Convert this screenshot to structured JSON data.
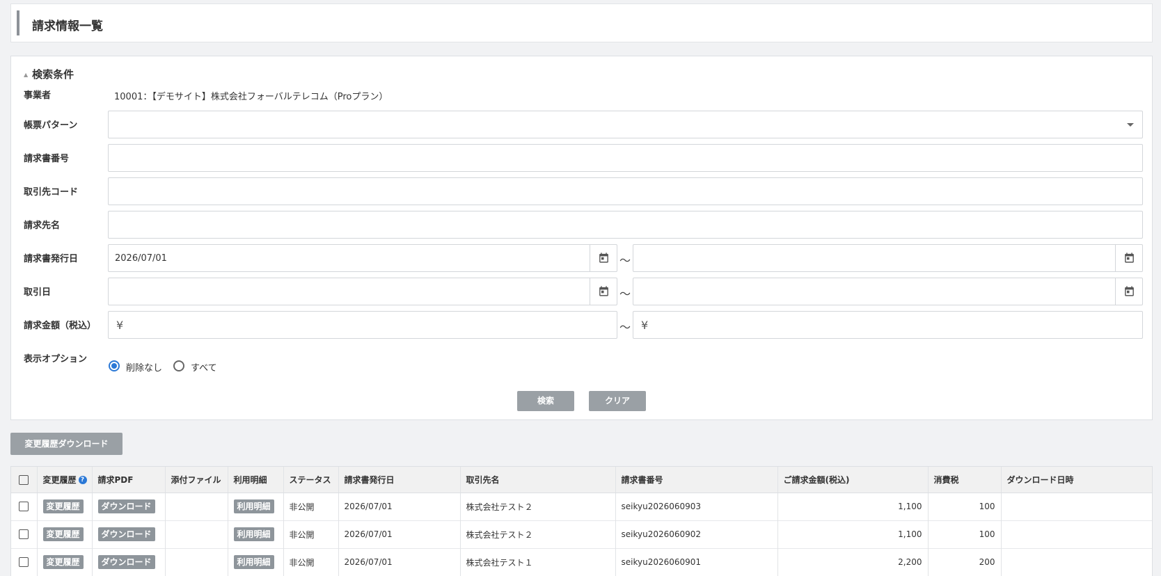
{
  "page": {
    "title": "請求情報一覧"
  },
  "search": {
    "section_title": "検索条件",
    "labels": {
      "business": "事業者",
      "pattern": "帳票パターン",
      "invoice_no": "請求書番号",
      "client_code": "取引先コード",
      "billing_name": "請求先名",
      "issue_date": "請求書発行日",
      "trade_date": "取引日",
      "amount": "請求金額（税込）",
      "display_option": "表示オプション"
    },
    "business_value": "10001：【デモサイト】株式会社フォーバルテレコム（Proプラン）",
    "pattern_value": "",
    "invoice_no_value": "",
    "client_code_value": "",
    "billing_name_value": "",
    "issue_date_from": "2026/07/01",
    "issue_date_to": "",
    "trade_date_from": "",
    "trade_date_to": "",
    "amount_prefix": "¥",
    "amount_from": "",
    "amount_to": "",
    "range_sep": "～",
    "option_no_delete": "削除なし",
    "option_all": "すべて",
    "selected_option": "削除なし",
    "search_button": "検索",
    "clear_button": "クリア"
  },
  "history_download_button": "変更履歴ダウンロード",
  "table": {
    "headers": [
      "変更履歴",
      "請求PDF",
      "添付ファイル",
      "利用明細",
      "ステータス",
      "請求書発行日",
      "取引先名",
      "請求書番号",
      "ご請求金額(税込)",
      "消費税",
      "ダウンロード日時"
    ],
    "history_button": "変更履歴",
    "download_button": "ダウンロード",
    "detail_button": "利用明細",
    "rows": [
      {
        "status": "非公開",
        "issue_date": "2026/07/01",
        "client": "株式会社テスト２",
        "invoice_no": "seikyu2026060903",
        "amount": "1,100",
        "tax": "100",
        "download_at": ""
      },
      {
        "status": "非公開",
        "issue_date": "2026/07/01",
        "client": "株式会社テスト２",
        "invoice_no": "seikyu2026060902",
        "amount": "1,100",
        "tax": "100",
        "download_at": ""
      },
      {
        "status": "非公開",
        "issue_date": "2026/07/01",
        "client": "株式会社テスト１",
        "invoice_no": "seikyu2026060901",
        "amount": "2,200",
        "tax": "200",
        "download_at": ""
      }
    ]
  },
  "icons": {
    "calendar": "calendar-icon",
    "help": "help-icon",
    "caret": "chevron-down-icon"
  },
  "colors": {
    "accent": "#2b78d6",
    "button_gray": "#9aa0a5"
  }
}
